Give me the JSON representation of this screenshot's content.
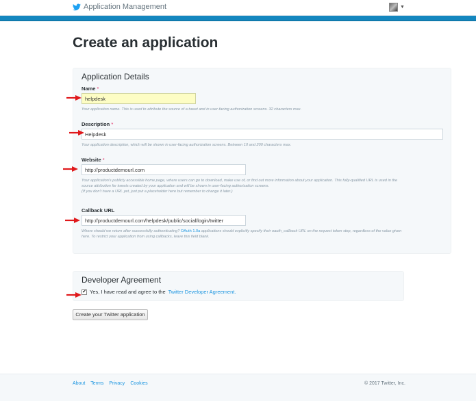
{
  "header": {
    "app_title": "Application Management",
    "logo_icon": "twitter-bird-icon",
    "menu_icon": "caret-down-icon"
  },
  "page": {
    "title": "Create an application"
  },
  "details": {
    "section_title": "Application Details",
    "required_mark": "*",
    "name": {
      "label": "Name",
      "value": "helpdesk",
      "help": "Your application name. This is used to attribute the source of a tweet and in user-facing authorization screens. 32 characters max."
    },
    "description": {
      "label": "Description",
      "value": "Helpdesk",
      "help": "Your application description, which will be shown in user-facing authorization screens. Between 10 and 200 characters max."
    },
    "website": {
      "label": "Website",
      "value": "http://productdemourl.com",
      "help_line1": "Your application's publicly accessible home page, where users can go to download, make use of, or find out more information about your application. This fully-qualified URL is used in the",
      "help_line2": "source attribution for tweets created by your application and will be shown in user-facing authorization screens.",
      "help_line3": "(If you don't have a URL yet, just put a placeholder here but remember to change it later.)"
    },
    "callback": {
      "label": "Callback URL",
      "value": "http://productdemourl.com/helpdesk/public/social/login/twitter",
      "help_pre": "Where should we return after successfully authenticating?",
      "help_link": "OAuth 1.0a",
      "help_post": "applications should explicitly specify their oauth_callback URL on the request token step, regardless of the value given",
      "help_line2": "here. To restrict your application from using callbacks, leave this field blank."
    }
  },
  "agreement": {
    "section_title": "Developer Agreement",
    "checked": true,
    "text": "Yes, I have read and agree to the",
    "link": "Twitter Developer Agreement.",
    "check_mark": "✔"
  },
  "actions": {
    "create_label": "Create your Twitter application"
  },
  "footer": {
    "links": [
      "About",
      "Terms",
      "Privacy",
      "Cookies"
    ],
    "copyright": "© 2017 Twitter, Inc."
  },
  "colors": {
    "accent_bar": "#1487bf",
    "link": "#1b95e0",
    "annotation_arrow": "#e0181b",
    "highlight_input": "#fdfdc4"
  }
}
